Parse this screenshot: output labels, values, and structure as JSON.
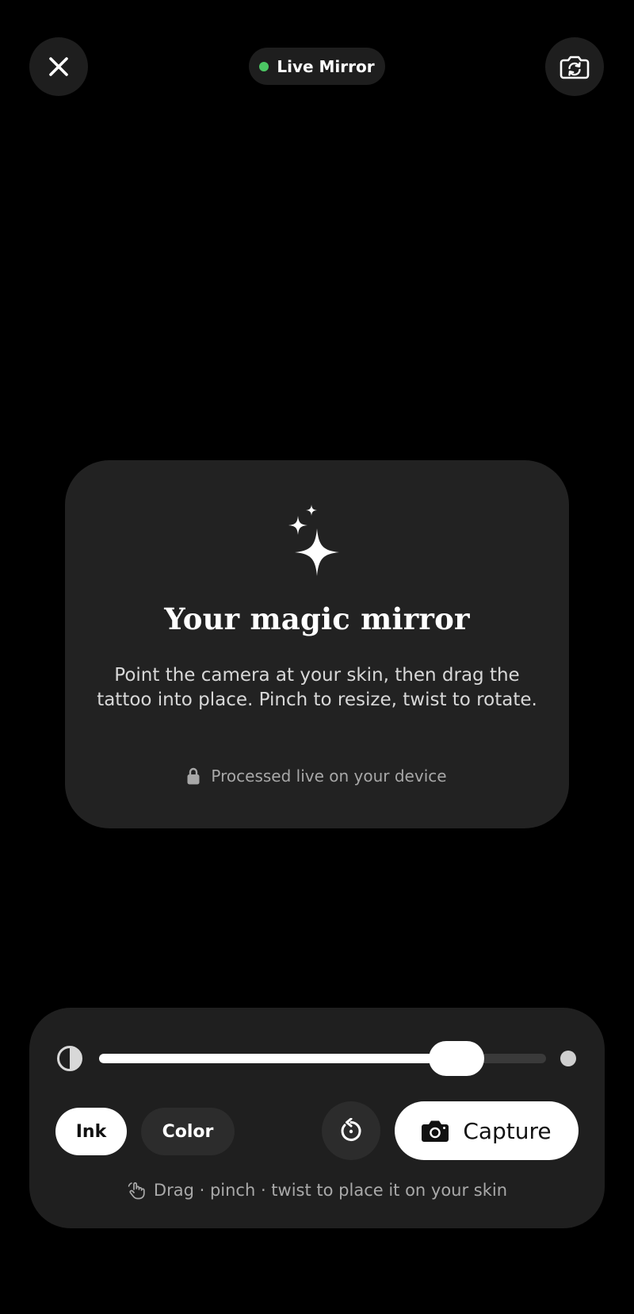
{
  "status": {
    "label": "Live Mirror",
    "dot_color": "#4cc764"
  },
  "top_bar": {
    "close_icon": "close-icon",
    "flip_icon": "camera-flip-icon"
  },
  "intro": {
    "icon": "sparkles-icon",
    "title": "Your magic mirror",
    "body": "Point the camera at your skin, then drag the tattoo into place. Pinch to resize, twist to rotate.",
    "footnote": "Processed live on your device",
    "footnote_icon": "lock-icon"
  },
  "controls": {
    "opacity_icon": "contrast-icon",
    "opacity_value": 0.8,
    "modes": [
      {
        "label": "Ink",
        "selected": true
      },
      {
        "label": "Color",
        "selected": false
      }
    ],
    "reset_icon": "rotate-reset-icon",
    "capture_label": "Capture",
    "capture_icon": "camera-icon",
    "hint": "Drag · pinch · twist to place it on your skin",
    "hint_icon": "hand-gesture-icon"
  }
}
